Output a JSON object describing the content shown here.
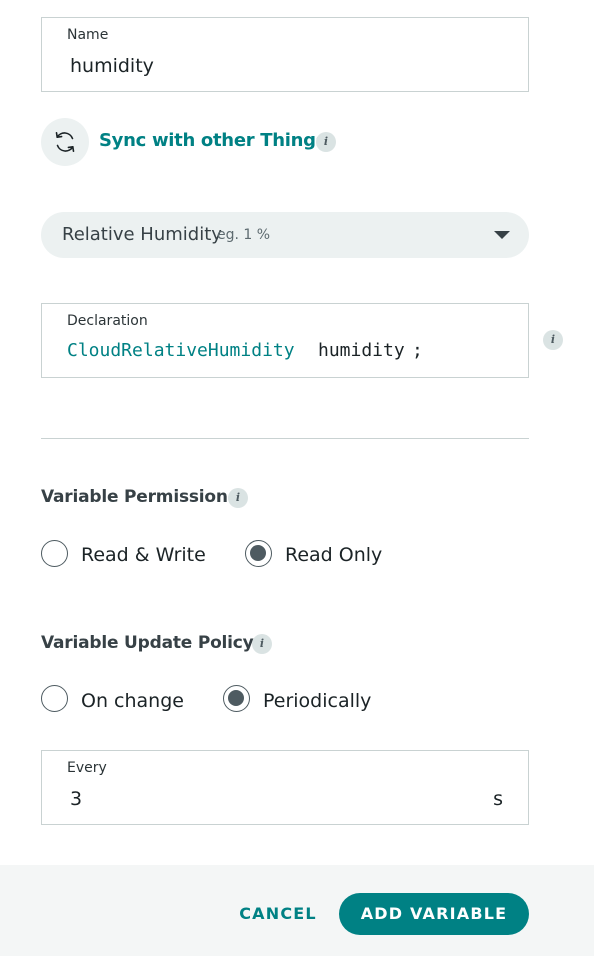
{
  "name_field": {
    "label": "Name",
    "value": "humidity"
  },
  "sync": {
    "label": "Sync with other Things",
    "icon": "sync-icon",
    "info_icon": "i"
  },
  "type_select": {
    "value": "Relative Humidity",
    "hint": "eg. 1 %",
    "icon": "chevron-down-icon"
  },
  "declaration": {
    "label": "Declaration",
    "type": "CloudRelativeHumidity",
    "variable": "humidity",
    "terminator": ";",
    "info_icon": "i"
  },
  "permission": {
    "title": "Variable Permission",
    "info_icon": "i",
    "options": [
      {
        "label": "Read & Write",
        "selected": false
      },
      {
        "label": "Read Only",
        "selected": true
      }
    ]
  },
  "update_policy": {
    "title": "Variable Update Policy",
    "info_icon": "i",
    "options": [
      {
        "label": "On change",
        "selected": false
      },
      {
        "label": "Periodically",
        "selected": true
      }
    ]
  },
  "every_field": {
    "label": "Every",
    "value": "3",
    "unit": "s"
  },
  "footer": {
    "cancel_label": "CANCEL",
    "add_label": "ADD VARIABLE"
  },
  "colors": {
    "accent": "#008184",
    "text": "#374146",
    "border": "#c9d2d2",
    "pill_bg": "#ecf1f1",
    "footer_bg": "#f4f6f6"
  }
}
